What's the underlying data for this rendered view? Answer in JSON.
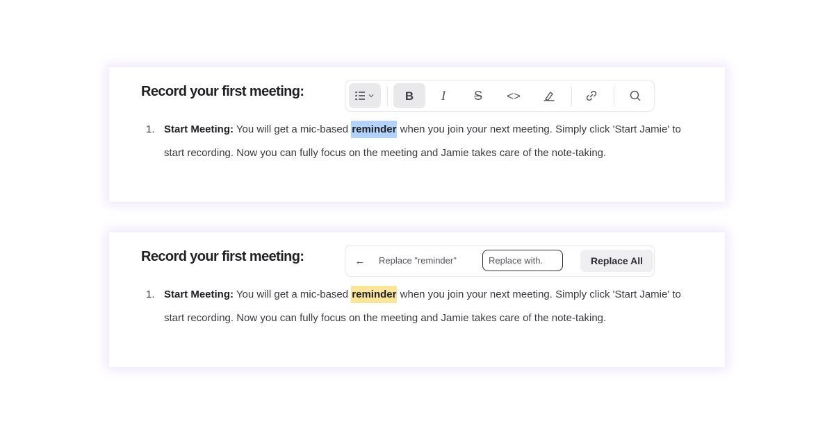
{
  "card_one": {
    "heading": "Record your first meeting:",
    "toolbar": {
      "list_icon": "list-format-icon",
      "bold_glyph": "B",
      "italic_glyph": "I",
      "strike_glyph": "S",
      "code_glyph": "<>",
      "highlight_icon": "highlighter-icon",
      "link_icon": "link-icon",
      "search_icon": "search-icon"
    },
    "list_number": "1.",
    "item": {
      "bold_lead": "Start Meeting:",
      "text_before": " You will get a mic-based ",
      "highlight": "reminder",
      "text_after": " when you join your next meeting. Simply click 'Start Jamie' to start recording. Now you can fully focus on the meeting and Jamie takes care of the note-taking."
    }
  },
  "card_two": {
    "heading": "Record your first meeting:",
    "replace_bar": {
      "back_arrow": "←",
      "label": "Replace \"reminder\"",
      "input_placeholder": "Replace with.",
      "input_value": "",
      "button_label": "Replace All"
    },
    "list_number": "1.",
    "item": {
      "bold_lead": "Start Meeting:",
      "text_before": " You will get a mic-based ",
      "highlight": "reminder",
      "text_after": " when you join your next meeting. Simply click 'Start Jamie' to start recording. Now you can fully focus on the meeting and Jamie takes care of the note-taking."
    }
  },
  "colors": {
    "selection_highlight": "#b4d3fb",
    "search_match_highlight": "#fbe59a",
    "card_glow": "#c8aaf5",
    "active_button_bg": "#e9e9ec"
  }
}
